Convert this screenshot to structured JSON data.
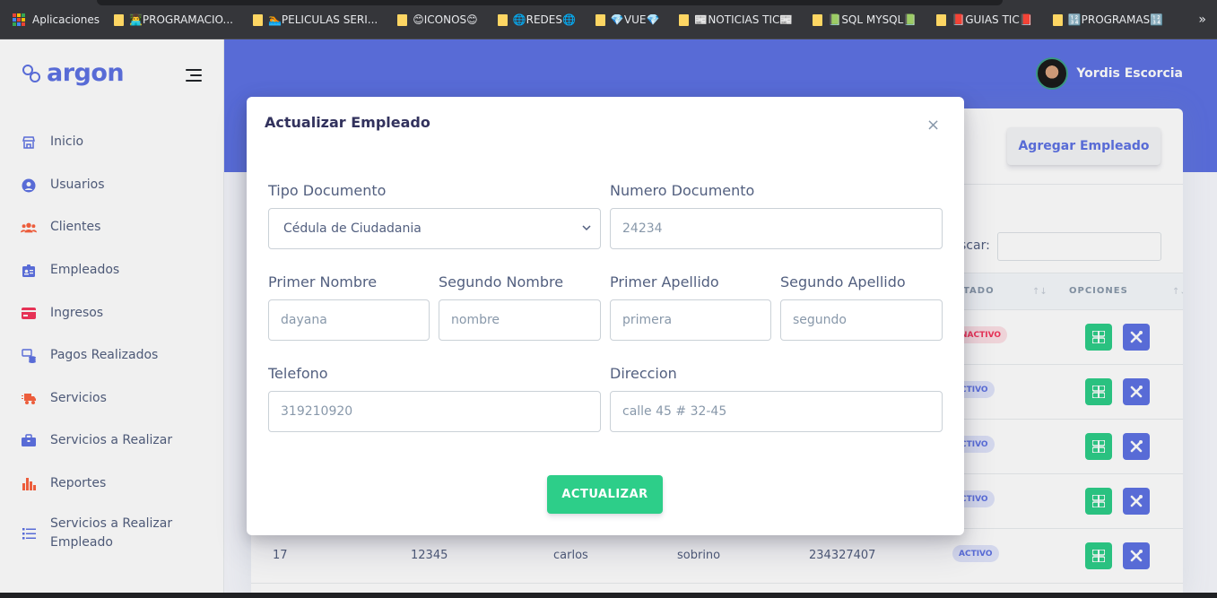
{
  "bookmarks": {
    "apps_label": "Aplicaciones",
    "items": [
      {
        "label": "👨‍💻PROGRAMACIO...",
        "icon": "folder-icon"
      },
      {
        "label": "🏊PELICULAS SERI...",
        "icon": "folder-icon"
      },
      {
        "label": "😊ICONOS😊",
        "icon": "folder-icon"
      },
      {
        "label": "🌐REDES🌐",
        "icon": "folder-icon"
      },
      {
        "label": "💎VUE💎",
        "icon": "folder-icon"
      },
      {
        "label": "📰NOTICIAS TIC📰",
        "icon": "folder-icon"
      },
      {
        "label": "📗SQL MYSQL📗",
        "icon": "folder-icon"
      },
      {
        "label": "📕GUIAS TIC📕",
        "icon": "folder-icon"
      },
      {
        "label": "🔢PROGRAMAS🔢",
        "icon": "folder-icon"
      }
    ],
    "more": "»"
  },
  "sidebar": {
    "brand": "argon",
    "items": [
      {
        "label": "Inicio",
        "icon": "shop-icon",
        "color": "#5e72e4"
      },
      {
        "label": "Usuarios",
        "icon": "user-circle-icon",
        "color": "#5e72e4"
      },
      {
        "label": "Clientes",
        "icon": "users-icon",
        "color": "#fb6340"
      },
      {
        "label": "Empleados",
        "icon": "id-badge-icon",
        "color": "#5e72e4"
      },
      {
        "label": "Ingresos",
        "icon": "credit-card-icon",
        "color": "#f5365c"
      },
      {
        "label": "Pagos Realizados",
        "icon": "money-icon",
        "color": "#5e72e4"
      },
      {
        "label": "Servicios",
        "icon": "truck-icon",
        "color": "#fb6340"
      },
      {
        "label": "Servicios a Realizar",
        "icon": "briefcase-icon",
        "color": "#5e72e4"
      },
      {
        "label": "Reportes",
        "icon": "bar-chart-icon",
        "color": "#fb6340"
      },
      {
        "label": "Servicios a Realizar Empleado",
        "icon": "list-icon",
        "color": "#5e72e4"
      }
    ]
  },
  "header": {
    "user_name": "Yordis Escorcia"
  },
  "card": {
    "add_button": "Agregar Empleado",
    "search_label": "scar:",
    "columns": {
      "estado": "TADO",
      "opciones": "OPCIONES"
    },
    "rows": [
      {
        "status": "NACTIVO",
        "status_type": "no",
        "id": "",
        "doc": "",
        "name": "",
        "surname": "",
        "phone": ""
      },
      {
        "status": "CTIVO",
        "status_type": "ok",
        "id": "",
        "doc": "",
        "name": "",
        "surname": "",
        "phone": ""
      },
      {
        "status": "CTIVO",
        "status_type": "ok",
        "id": "",
        "doc": "",
        "name": "",
        "surname": "",
        "phone": ""
      },
      {
        "status": "CTIVO",
        "status_type": "ok",
        "id": "",
        "doc": "",
        "name": "",
        "surname": "",
        "phone": ""
      },
      {
        "status": "ACTIVO",
        "status_type": "ok",
        "id": "17",
        "doc": "12345",
        "name": "carlos",
        "surname": "sobrino",
        "phone": "234327407"
      }
    ]
  },
  "modal": {
    "title": "Actualizar Empleado",
    "close": "×",
    "fields": {
      "tipo_documento": {
        "label": "Tipo Documento",
        "value": "Cédula de Ciudadania"
      },
      "numero_documento": {
        "label": "Numero Documento",
        "value": "24234"
      },
      "primer_nombre": {
        "label": "Primer Nombre",
        "value": "dayana"
      },
      "segundo_nombre": {
        "label": "Segundo Nombre",
        "value": "nombre"
      },
      "primer_apellido": {
        "label": "Primer Apellido",
        "value": "primera"
      },
      "segundo_apellido": {
        "label": "Segundo Apellido",
        "value": "segundo"
      },
      "telefono": {
        "label": "Telefono",
        "value": "319210920"
      },
      "direccion": {
        "label": "Direccion",
        "value": "calle 45 # 32-45"
      }
    },
    "submit": "ACTUALIZAR"
  },
  "colors": {
    "primary": "#5e72e4",
    "success": "#2dce89",
    "danger": "#f5365c",
    "warning": "#fb6340"
  }
}
